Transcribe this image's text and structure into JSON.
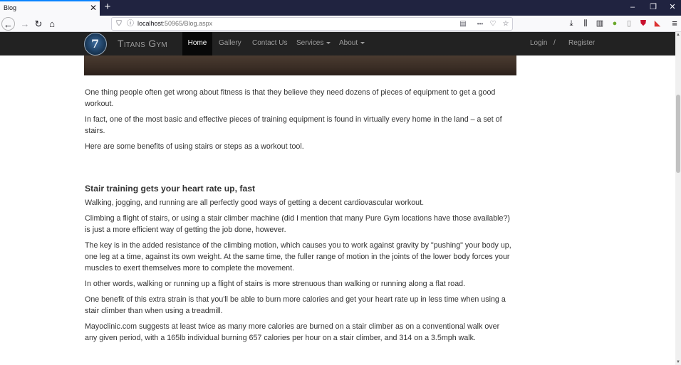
{
  "browser": {
    "tab_title": "Blog",
    "tab_close": "✕",
    "new_tab": "+",
    "window_controls": {
      "minimize": "–",
      "restore": "❐",
      "close": "✕"
    },
    "url_host": "localhost",
    "url_rest": ":50965/Blog.aspx",
    "icons": {
      "back": "←",
      "forward": "→",
      "reload": "↻",
      "home": "⌂",
      "shield": "⛉",
      "info": "ⓘ",
      "reader": "▤",
      "more": "•••",
      "pocket": "♡",
      "bookmark": "☆",
      "download": "⤓",
      "library": "⫼",
      "sidebar": "▥",
      "ext1": "●",
      "ext2": "▯",
      "ext3": "⛊",
      "ext4": "◣",
      "menu": "≡"
    }
  },
  "site": {
    "brand": "Titans Gym",
    "nav": {
      "home": "Home",
      "gallery": "Gallery",
      "contact": "Contact Us",
      "services": "Services",
      "about": "About",
      "login": "Login",
      "separator": "/",
      "register": "Register"
    }
  },
  "article": {
    "p1": "One thing people often get wrong about fitness is that they believe they need dozens of pieces of equipment to get a good workout.",
    "p2": "In fact, one of the most basic and effective pieces of training equipment is found in virtually every home in the land – a set of stairs.",
    "p3": "Here are some benefits of using stairs or steps as a workout tool.",
    "h1": "Stair training gets your heart rate up, fast",
    "p4": "Walking, jogging, and running are all perfectly good ways of getting a decent cardiovascular workout.",
    "p5": "Climbing a flight of stairs, or using a stair climber machine (did I mention that many Pure Gym locations have those available?) is just a more efficient way of getting the job done, however.",
    "p6": "The key is in the added resistance of the climbing motion, which causes you to work against gravity by \"pushing\" your body up, one leg at a time, against its own weight. At the same time, the fuller range of motion in the joints of the lower body forces your muscles to exert themselves more to complete the movement.",
    "p7": "In other words, walking or running up a flight of stairs is more strenuous than walking or running along a flat road.",
    "p8": "One benefit of this extra strain is that you'll be able to burn more calories and get your heart rate up in less time when using a stair climber than when using a treadmill.",
    "p9": "Mayoclinic.com suggests at least twice as many more calories are burned on a stair climber as on a conventional walk over any given period, with a 165lb individual burning 657 calories per hour on a stair climber, and 314 on a 3.5mph walk."
  },
  "colors": {
    "tabbar": "#202340",
    "site_nav": "#222222",
    "site_nav_active": "#080808",
    "text": "#333333",
    "accent": "#0a84ff"
  }
}
